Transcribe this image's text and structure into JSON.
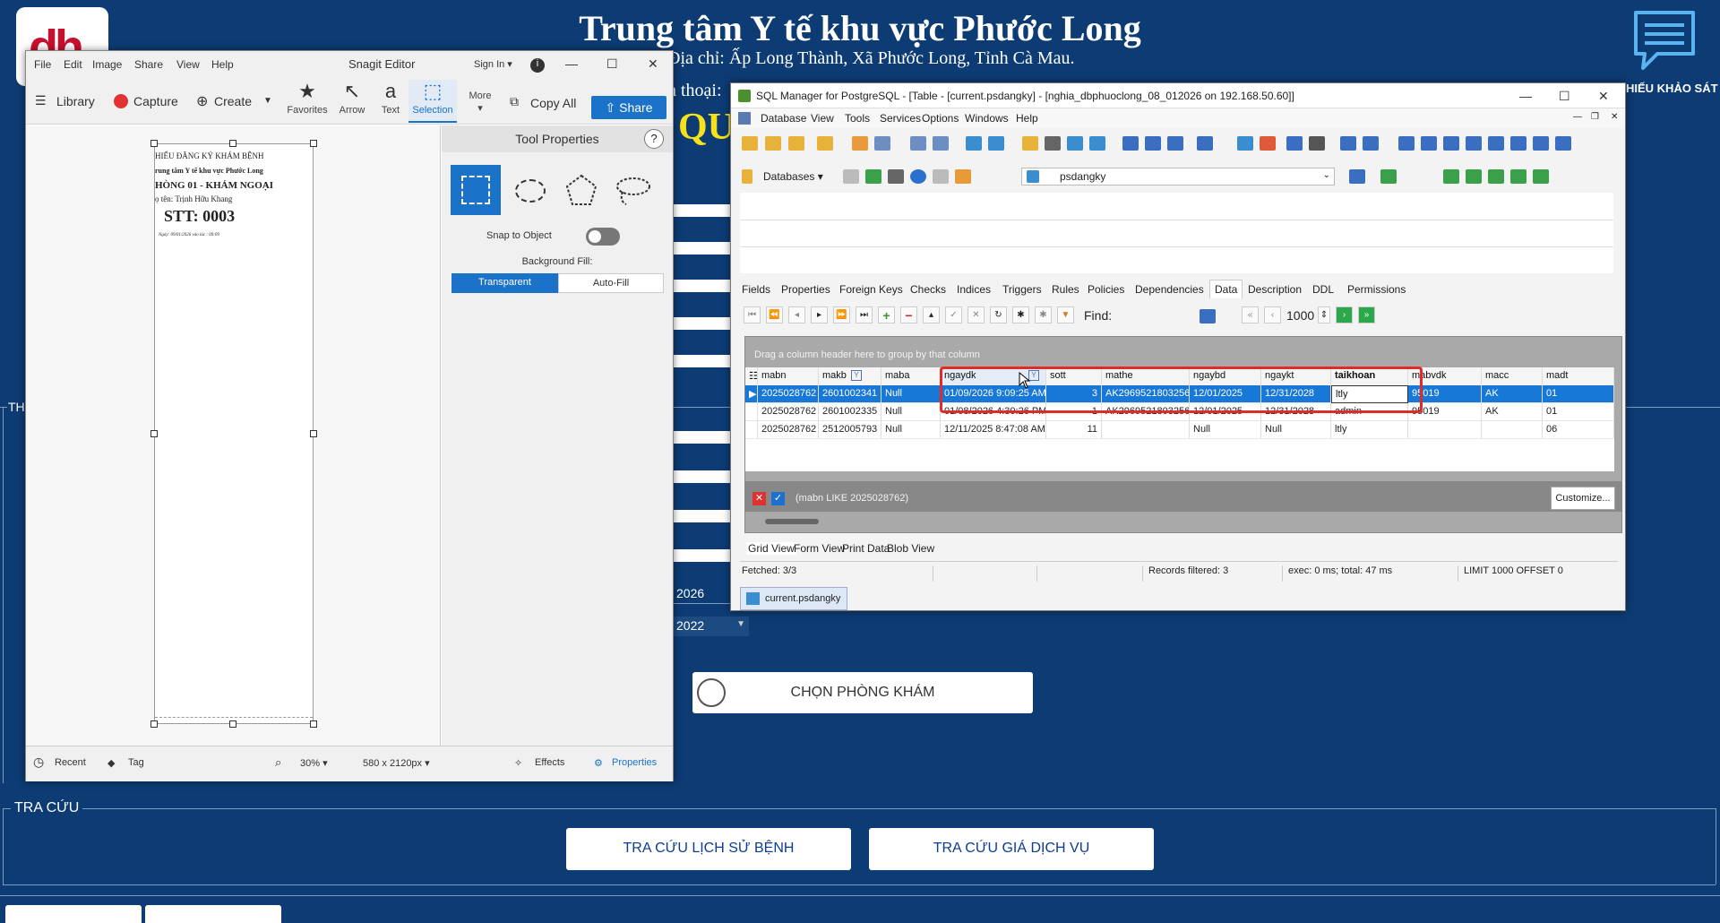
{
  "bg": {
    "title": "Trung tâm Y tế khu vực Phước Long",
    "address": "Địa chỉ: Ấp Long Thành, Xã Phước Long, Tỉnh Cà Mau.",
    "phone": "n thoại:",
    "qu": "QU",
    "survey_label": "HIẾU KHẢO SÁT",
    "th_fragment": "TH",
    "year1": "2026",
    "year2": "2022",
    "room_button": "CHỌN PHÒNG KHÁM",
    "tracuu_legend": "TRA CỨU",
    "history_button": "TRA CỨU LỊCH SỬ BỆNH",
    "price_button": "TRA CỨU GIÁ DỊCH VỤ",
    "logo_text": "dh"
  },
  "snagit": {
    "menu": [
      "File",
      "Edit",
      "Image",
      "Share",
      "View",
      "Help"
    ],
    "title": "Snagit Editor",
    "signin": "Sign In ▾",
    "library": "Library",
    "capture": "Capture",
    "create": "Create",
    "tools": [
      {
        "label": "Favorites",
        "icon": "star-icon"
      },
      {
        "label": "Arrow",
        "icon": "arrow-icon"
      },
      {
        "label": "Text",
        "icon": "text-icon"
      },
      {
        "label": "Selection",
        "icon": "selection-icon"
      },
      {
        "label": "More",
        "icon": "more-icon"
      }
    ],
    "copy_all": "Copy All",
    "share": "Share",
    "doc": {
      "l1": "HIẾU ĐĂNG KÝ KHÁM  BỆNH",
      "l2": "rung tâm Y tế khu vực Phước Long",
      "l3": "HÒNG 01 - KHÁM NGOẠI",
      "l4": "ọ tên: Trịnh Hữu Khang",
      "l5": "STT: 0003",
      "l6": "Ngày: 09/01/2026          vào lúc : 09:09"
    },
    "props": {
      "title": "Tool Properties",
      "help": "?",
      "snap": "Snap to Object",
      "bgfill": "Background Fill:",
      "transparent": "Transparent",
      "autofill": "Auto-Fill"
    },
    "status": {
      "recent": "Recent",
      "tag": "Tag",
      "zoom": "30% ▾",
      "size": "580 x 2120px ▾",
      "effects": "Effects",
      "properties": "Properties"
    }
  },
  "sql": {
    "title": "SQL Manager for PostgreSQL - [Table - [current.psdangky] - [nghia_dbphuoclong_08_012026 on 192.168.50.60]]",
    "menu": [
      "Database",
      "View",
      "Tools",
      "Services",
      "Options",
      "Windows",
      "Help"
    ],
    "databases": "Databases",
    "table_combo": "psdangky",
    "tabs": [
      "Fields",
      "Properties",
      "Foreign Keys",
      "Checks",
      "Indices",
      "Triggers",
      "Rules",
      "Policies",
      "Dependencies",
      "Data",
      "Description",
      "DDL",
      "Permissions"
    ],
    "find_label": "Find:",
    "limit": "1000",
    "group_hint": "Drag a column header here to group by that column",
    "columns": [
      "mabn",
      "makb",
      "maba",
      "ngaydk",
      "sott",
      "mathe",
      "ngaybd",
      "ngaykt",
      "taikhoan",
      "mabvdk",
      "macc",
      "madt"
    ],
    "rows": [
      [
        "2025028762",
        "2601002341",
        "Null",
        "01/09/2026 9:09:25 AM",
        "3",
        "AK2969521803256",
        "12/01/2025",
        "12/31/2028",
        "ltly",
        "95019",
        "AK",
        "01"
      ],
      [
        "2025028762",
        "2601002335",
        "Null",
        "01/08/2026 4:30:26 PM",
        "1",
        "AK2969521803256",
        "12/01/2025",
        "12/31/2028",
        "admin",
        "95019",
        "AK",
        "01"
      ],
      [
        "2025028762",
        "2512005793",
        "Null",
        "12/11/2025 8:47:08 AM",
        "11",
        "",
        "Null",
        "Null",
        "ltly",
        "",
        "",
        "06"
      ]
    ],
    "filter_text": "(mabn LIKE 2025028762)",
    "customize": "Customize...",
    "view_tabs": [
      "Grid View",
      "Form View",
      "Print Data",
      "Blob View"
    ],
    "status": [
      "Fetched: 3/3",
      "",
      "",
      "Records filtered: 3",
      "exec: 0 ms; total: 47 ms",
      "LIMIT 1000 OFFSET 0"
    ],
    "doc_tab": "current.psdangky"
  },
  "colors": {
    "page_bg": "#0d3b73",
    "selected_row": "#1878d8",
    "highlight": "#e02b2b",
    "snagit_blue": "#1a73c8"
  }
}
